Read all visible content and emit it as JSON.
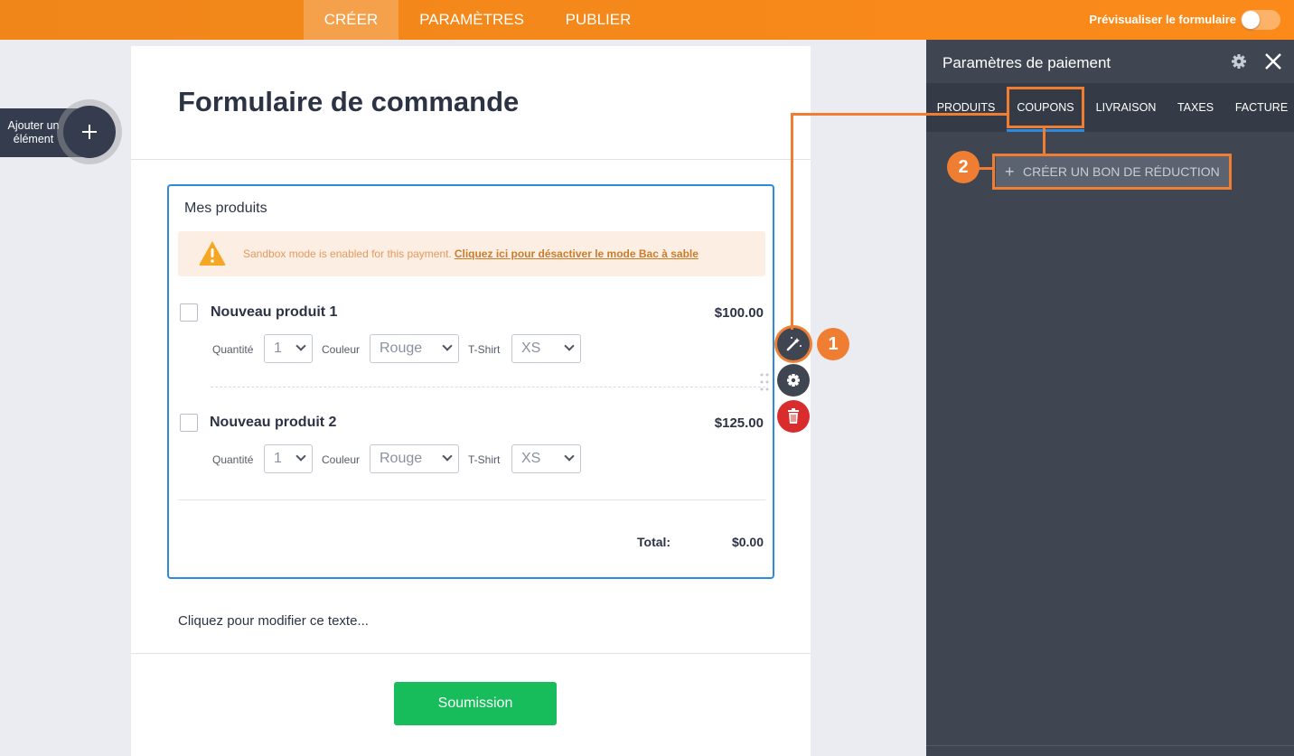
{
  "topbar": {
    "tabs": [
      {
        "label": "CRÉER",
        "active": true
      },
      {
        "label": "PARAMÈTRES",
        "active": false
      },
      {
        "label": "PUBLIER",
        "active": false
      }
    ],
    "preview_label": "Prévisualiser le formulaire",
    "preview_on": false
  },
  "add_element": {
    "label": "Ajouter un élément",
    "icon": "plus-icon"
  },
  "form": {
    "title": "Formulaire de commande",
    "product_block": {
      "label": "Mes produits",
      "sandbox": {
        "icon": "warning-icon",
        "text": "Sandbox mode is enabled for this payment.",
        "link": "Cliquez ici pour désactiver le mode Bac à sable"
      },
      "products": [
        {
          "name": "Nouveau produit 1",
          "price": "$100.00",
          "checked": false,
          "options": [
            {
              "label": "Quantité",
              "value": "1"
            },
            {
              "label": "Couleur",
              "value": "Rouge"
            },
            {
              "label": "T-Shirt",
              "value": "XS"
            }
          ]
        },
        {
          "name": "Nouveau produit 2",
          "price": "$125.00",
          "checked": false,
          "options": [
            {
              "label": "Quantité",
              "value": "1"
            },
            {
              "label": "Couleur",
              "value": "Rouge"
            },
            {
              "label": "T-Shirt",
              "value": "XS"
            }
          ]
        }
      ],
      "total_label": "Total:",
      "total_value": "$0.00"
    },
    "editable_text": "Cliquez pour modifier ce texte...",
    "submit_label": "Soumission"
  },
  "tools": [
    {
      "icon": "magic-wand-icon"
    },
    {
      "icon": "gear-icon"
    },
    {
      "icon": "trash-icon"
    }
  ],
  "annotations": [
    {
      "number": "1"
    },
    {
      "number": "2"
    }
  ],
  "panel": {
    "title": "Paramètres de paiement",
    "tabs": [
      {
        "label": "PRODUITS",
        "active": false
      },
      {
        "label": "COUPONS",
        "active": true
      },
      {
        "label": "LIVRAISON",
        "active": false
      },
      {
        "label": "TAXES",
        "active": false
      },
      {
        "label": "FACTURE",
        "active": false
      }
    ],
    "create_button": "CRÉER UN BON DE RÉDUCTION"
  },
  "colors": {
    "brand_orange": "#f88a1a",
    "annotation_orange": "#f07e32",
    "active_blue": "#2e8bdc",
    "submit_green": "#18bd5b",
    "delete_red": "#d92c2c",
    "panel_dark": "#3f4551"
  }
}
